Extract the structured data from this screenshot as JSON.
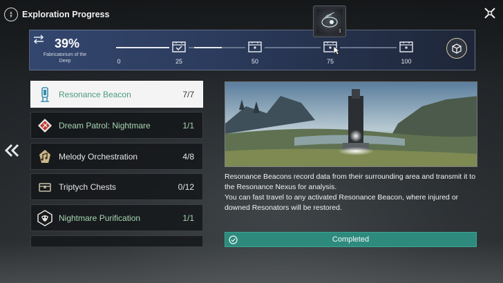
{
  "window": {
    "title": "Exploration Progress"
  },
  "progress": {
    "percent_label": "39%",
    "location": "Fabricatorium of the Deep",
    "completion": 0.39,
    "milestones": [
      {
        "label": "0",
        "claimed": false,
        "marker": "none"
      },
      {
        "label": "25",
        "claimed": true,
        "marker": "chest"
      },
      {
        "label": "50",
        "claimed": false,
        "marker": "chest"
      },
      {
        "label": "75",
        "claimed": false,
        "marker": "chest"
      },
      {
        "label": "100",
        "claimed": false,
        "marker": "chest"
      }
    ],
    "reward_popup": {
      "icon": "echo-item-icon",
      "count": "1"
    }
  },
  "activities": [
    {
      "label": "Resonance Beacon",
      "count": "7/7",
      "icon": "beacon-icon",
      "active": true,
      "complete": true
    },
    {
      "label": "Dream Patrol: Nightmare",
      "count": "1/1",
      "icon": "nightmare-patrol-icon",
      "active": false,
      "complete": true
    },
    {
      "label": "Melody Orchestration",
      "count": "4/8",
      "icon": "melody-icon",
      "active": false,
      "complete": false
    },
    {
      "label": "Triptych Chests",
      "count": "0/12",
      "icon": "chest-icon",
      "active": false,
      "complete": false
    },
    {
      "label": "Nightmare Purification",
      "count": "1/1",
      "icon": "purification-icon",
      "active": false,
      "complete": true
    }
  ],
  "detail": {
    "paragraph1": "Resonance Beacons record data from their surrounding area and transmit it to the Resonance Nexus for analysis.",
    "paragraph2": "You can fast travel to any activated Resonance Beacon, where injured or downed Resonators will be restored.",
    "status": "Completed"
  },
  "colors": {
    "accent_green": "#2e8a7d",
    "complete_text": "#a7d6b3",
    "panel_blue": "#33466e"
  }
}
